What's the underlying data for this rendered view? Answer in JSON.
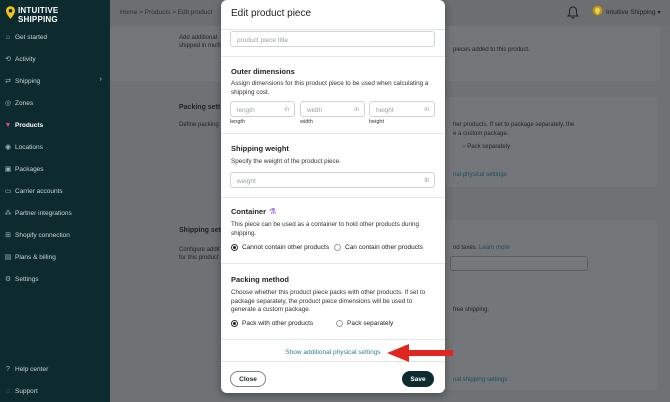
{
  "brand": {
    "line1": "INTUITIVE",
    "line2": "SHIPPING",
    "accent": "#f5c518"
  },
  "sidebar": {
    "items": [
      {
        "label": "Get started",
        "icon": "home-icon"
      },
      {
        "label": "Activity",
        "icon": "activity-icon"
      },
      {
        "label": "Shipping",
        "icon": "shipping-icon"
      },
      {
        "label": "Zones",
        "icon": "zones-icon"
      },
      {
        "label": "Products",
        "icon": "products-icon",
        "active": true
      },
      {
        "label": "Locations",
        "icon": "location-icon"
      },
      {
        "label": "Packages",
        "icon": "package-icon"
      },
      {
        "label": "Carrier accounts",
        "icon": "carrier-icon"
      },
      {
        "label": "Partner integrations",
        "icon": "integration-icon"
      },
      {
        "label": "Shopify connection",
        "icon": "shopify-icon"
      },
      {
        "label": "Plans & billing",
        "icon": "billing-icon"
      },
      {
        "label": "Settings",
        "icon": "gear-icon"
      }
    ],
    "footer": [
      {
        "label": "Help center",
        "icon": "help-icon"
      },
      {
        "label": "Support",
        "icon": "support-icon"
      }
    ]
  },
  "header": {
    "breadcrumb": "Home > Products > Edit product",
    "account": "Intuitive Shipping"
  },
  "background": {
    "card1_text_a": "Add additional",
    "card1_text_b": "shipped in multi",
    "card1_right": "pieces added to this product.",
    "packing_title": "Packing sett",
    "packing_desc": "Define packing",
    "packing_right_a": "her products. If set to package separately, the",
    "packing_right_b": "e a custom package.",
    "pack_sep": "Pack separately",
    "phys_link": "nal physical settings",
    "ship_title": "Shipping sett",
    "ship_desc_a": "Configure addit",
    "ship_desc_b": "for this product",
    "taxes": "nd taxes.",
    "learn_more": "Learn more",
    "free_ship": "free shipping.",
    "ship_link": "nal shipping settings"
  },
  "modal": {
    "title": "Edit product piece",
    "title_placeholder": "product piece title",
    "outer": {
      "title": "Outer dimensions",
      "desc": "Assign dimensions for this product piece to be used when calculating a shipping cost.",
      "fields": [
        {
          "placeholder": "length",
          "unit": "in",
          "label": "length"
        },
        {
          "placeholder": "width",
          "unit": "in",
          "label": "width"
        },
        {
          "placeholder": "height",
          "unit": "in",
          "label": "height"
        }
      ]
    },
    "weight": {
      "title": "Shipping weight",
      "desc": "Specify the weight of the product piece.",
      "placeholder": "weight",
      "unit": "lb"
    },
    "container": {
      "title": "Container",
      "desc": "This piece can be used as a container to hold other products during shipping.",
      "option1": "Cannot contain other products",
      "option2": "Can contain other products"
    },
    "packing": {
      "title": "Packing method",
      "desc": "Choose whether this product piece packs with other products. If set to package separately, the product piece dimensions will be used to generate a custom package.",
      "option1": "Pack with other products",
      "option2": "Pack separately"
    },
    "show_more": "Show additional physical settings",
    "close": "Close",
    "save": "Save"
  },
  "colors": {
    "sidebar": "#0d2b2e",
    "link": "#2f7f95",
    "arrow": "#e0261f"
  }
}
